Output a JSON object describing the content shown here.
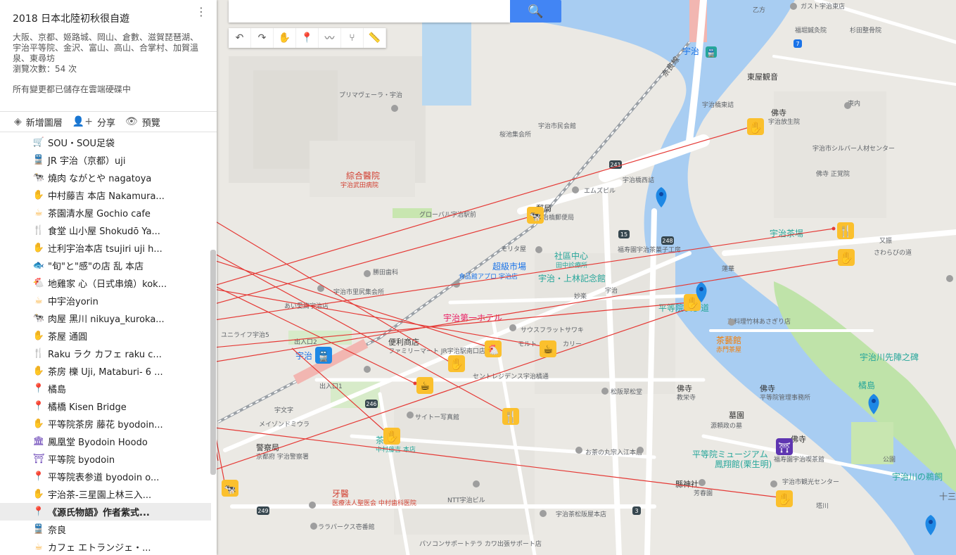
{
  "panel": {
    "title": "2018 日本北陸初秋很自遊",
    "description": "大阪、京都、姬路城、岡山、倉數、滋賀琵琶湖、宇治平等院、金沢、富山、高山、合掌村、加賀溫泉、東尋坊",
    "view_count": "瀏覽次數：54 次",
    "saved_status": "所有變更都已儲存在雲端硬碟中",
    "toolbar": {
      "add_layer": "新增圖層",
      "share": "分享",
      "preview": "預覽"
    }
  },
  "search": {
    "placeholder": ""
  },
  "items": [
    {
      "label": "SOU・SOU足袋",
      "icon": "shop-icon",
      "glyph": "🛒",
      "color": "#f9a825"
    },
    {
      "label": "JR 宇治（京都）uji",
      "icon": "train-icon",
      "glyph": "🚆",
      "color": "#1e88e5"
    },
    {
      "label": "燒肉 ながとや nagatoya",
      "icon": "cow-icon",
      "glyph": "🐄",
      "color": "#f9a825"
    },
    {
      "label": "中村藤吉 本店 Nakamura...",
      "icon": "hand-icon",
      "glyph": "✋",
      "color": "#f9a825"
    },
    {
      "label": "茶園清水屋 Gochio cafe",
      "icon": "cafe-icon",
      "glyph": "☕",
      "color": "#f9a825"
    },
    {
      "label": "食堂 山小屋 Shokudō Ya...",
      "icon": "restaurant-icon",
      "glyph": "🍴",
      "color": "#f9a825"
    },
    {
      "label": "辻利宇治本店 tsujiri uji h...",
      "icon": "hand-icon",
      "glyph": "✋",
      "color": "#f9a825"
    },
    {
      "label": "\"旬\"と\"感\"の店 乱 本店",
      "icon": "fish-icon",
      "glyph": "🐟",
      "color": "#f9a825"
    },
    {
      "label": "地雞家 心（日式串燒）kok...",
      "icon": "chicken-icon",
      "glyph": "🐔",
      "color": "#f9a825"
    },
    {
      "label": "中宇治yorin",
      "icon": "cafe-icon",
      "glyph": "☕",
      "color": "#f9a825"
    },
    {
      "label": "肉屋 黑川 nikuya_kuroka...",
      "icon": "cow-icon",
      "glyph": "🐄",
      "color": "#f9a825"
    },
    {
      "label": "茶屋 通圓",
      "icon": "hand-icon",
      "glyph": "✋",
      "color": "#f9a825"
    },
    {
      "label": "Raku ラク カフェ raku c...",
      "icon": "restaurant-icon",
      "glyph": "🍴",
      "color": "#f9a825"
    },
    {
      "label": "茶房 櫟 Uji, Mataburi- 6 ...",
      "icon": "hand-icon",
      "glyph": "✋",
      "color": "#f9a825"
    },
    {
      "label": "橘島",
      "icon": "pin-icon",
      "glyph": "📍",
      "color": "#1e88e5"
    },
    {
      "label": "橘橋 Kisen Bridge",
      "icon": "pin-icon",
      "glyph": "📍",
      "color": "#1e88e5"
    },
    {
      "label": "平等院茶房 藤花 byodoin...",
      "icon": "hand-icon",
      "glyph": "✋",
      "color": "#f9a825"
    },
    {
      "label": "鳳凰堂 Byodoin Hoodo",
      "icon": "temple-icon",
      "glyph": "🏛",
      "color": "#5e35b1"
    },
    {
      "label": "平等院 byodoin",
      "icon": "shrine-icon",
      "glyph": "⛩",
      "color": "#5e35b1"
    },
    {
      "label": "平等院表参道 byodoin o...",
      "icon": "pin-icon",
      "glyph": "📍",
      "color": "#1e88e5"
    },
    {
      "label": "宇治茶-三星園上林三入...",
      "icon": "hand-icon",
      "glyph": "✋",
      "color": "#f9a825"
    },
    {
      "label": "《源氏物語》作者紫式...",
      "icon": "pin-icon",
      "glyph": "📍",
      "color": "#1e88e5",
      "selected": true
    },
    {
      "label": "奈良",
      "icon": "train-icon",
      "glyph": "🚆",
      "color": "#1e88e5"
    },
    {
      "label": "カフェ エトランジェ・...",
      "icon": "cafe-icon",
      "glyph": "☕",
      "color": "#f9a825"
    }
  ],
  "map_labels": {
    "uji_station": "宇治",
    "otsu_line": "乙方",
    "gusto": "ガスト宇治東店",
    "fukushima": "福堀鍼灸院",
    "sugita": "杉田整骨院",
    "higashiya": "東屋観音",
    "ujibashi_east": "宇治橋東詰",
    "buddhist": "佛寺",
    "gyokuho": "宇治放生院",
    "higashiuchi": "東内",
    "silver": "宇治市シルバー人材センター",
    "shoukakuin": "佛寺 正覚院",
    "primavera": "プリマヴェーラ・宇治",
    "sakuradani": "桜池集会所",
    "shiminkai": "宇治市民会館",
    "hospital": "綜合醫院",
    "hospital_sub": "宇治武田病院",
    "ujibashi_west": "宇治橋西詰",
    "mspil": "エムズピル",
    "global": "グローバル宇治駅前",
    "post": "郵局",
    "post_sub": "宇治橋郵便局",
    "teahouse_sign": "宇治茶場",
    "matashin": "又振",
    "sawara": "さわらびの道",
    "morita": "モリタ屋",
    "fukujuen": "福寿園宇治茶菓子工房",
    "community": "社區中心",
    "community_sub": "田中診療所",
    "supermarket": "超級市場",
    "supermarket_sub": "食品館アプロ 宇治店",
    "katsuta": "勝田歯科",
    "uji_kamibayashi": "宇治・上林記念館",
    "myouraku": "妙楽",
    "uji": "宇治",
    "renge": "蓮華",
    "satohalls": "宇治市里尻集会所",
    "aikyo": "あい愛腐宇治店",
    "hotel": "宇治第一ホテル",
    "sarafoodsurf": "サウスフラットサワキ",
    "byodo_omote": "平等院表参道",
    "kyoryori": "京料理竹林あさぎり店",
    "chabouya": "茶藝館",
    "chabouya_sub": "赤門茶屋",
    "unilife": "ユニライフ宇治5",
    "exit2": "出入口2",
    "uji_st": "宇治",
    "convenience": "便利商店",
    "convenience_sub": "ファミリーマート JR宇治駅南口店",
    "molto": "モルト",
    "curry": "カリー",
    "rapids": "宇治川先陣之碑",
    "exit1": "出入口1",
    "central": "セントレジデンス宇治橘通",
    "buddhist2": "佛寺",
    "kyousyu": "教栄寺",
    "buddhist3": "佛寺",
    "byodo_mgmt": "平等院管理事務所",
    "tachibanajima": "橘島",
    "matsuzaka": "松阪翠松堂",
    "ujibunji": "宇文字",
    "mainsonmiura": "メイゾンドミウラ",
    "saiton": "サイトー写真館",
    "grave": "墓園",
    "genji_grave": "源頼政の墓",
    "kouen": "公園",
    "police": "警察局",
    "police_sub": "京都府 宇治警察署",
    "tea_nakamura": "茶",
    "tea_nakamura_sub": "中村藤吉 本店",
    "byodoin_museum": "平等院ミュージアム",
    "hououshou": "鳳翔館(栗生明)",
    "buddhist4": "佛寺",
    "fukuju_cafe": "福寿園宇治喫茶館",
    "uji_tourism": "宇治市観光センター",
    "ujigawa_ukai": "宇治川の鵜飼",
    "ochanomaru": "お茶の丸宗入江本店",
    "kenjinsha": "縣神社",
    "hougetsudo": "芳春園",
    "dentist": "牙醫",
    "dentist_sub": "医療法人聖医会 中村歯科医院",
    "ntt": "NTT宇治ビル",
    "lalapark": "ララパークス壱番館",
    "shousuki": "宇治茶松阪屋本店",
    "tonegawa": "塔川",
    "pc": "パソコンサポートテラ カワ出張サポート店",
    "nara_line": "奈良線",
    "jusan": "十三",
    "r241": "241",
    "r15": "15",
    "r248": "248",
    "r246": "246",
    "r249": "249",
    "r3": "3",
    "r7": "7"
  }
}
